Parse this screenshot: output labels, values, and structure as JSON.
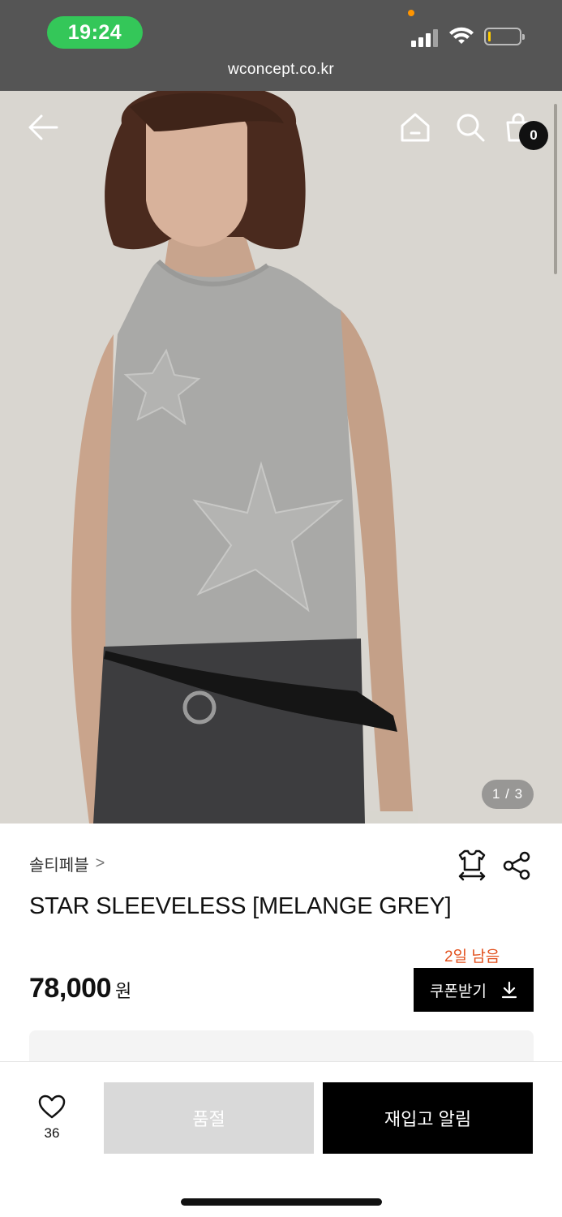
{
  "status_bar": {
    "time": "19:24",
    "url": "wconcept.co.kr",
    "icons": [
      "signal-icon",
      "wifi-icon",
      "battery-icon"
    ]
  },
  "header": {
    "icons": [
      "back-arrow-icon",
      "home-icon",
      "search-icon",
      "shopping-bag-icon"
    ],
    "cart_count": "0"
  },
  "gallery": {
    "counter": "1 / 3"
  },
  "product": {
    "brand": "솔티페블",
    "brand_chevron": ">",
    "title": "STAR SLEEVELESS [MELANGE GREY]",
    "days_left": "2일 남음",
    "price": "78,000",
    "currency": "원",
    "coupon_label": "쿠폰받기",
    "icons": [
      "size-guide-icon",
      "share-icon",
      "download-icon"
    ]
  },
  "bottom_bar": {
    "like_count": "36",
    "soldout_label": "품절",
    "restock_label": "재입고 알림",
    "icons": [
      "heart-icon"
    ]
  },
  "colors": {
    "status_bar_bg": "#555555",
    "time_pill": "#34c759",
    "accent_orange": "#e2501d",
    "primary_black": "#000000",
    "soldout_grey": "#d9d9d9"
  }
}
